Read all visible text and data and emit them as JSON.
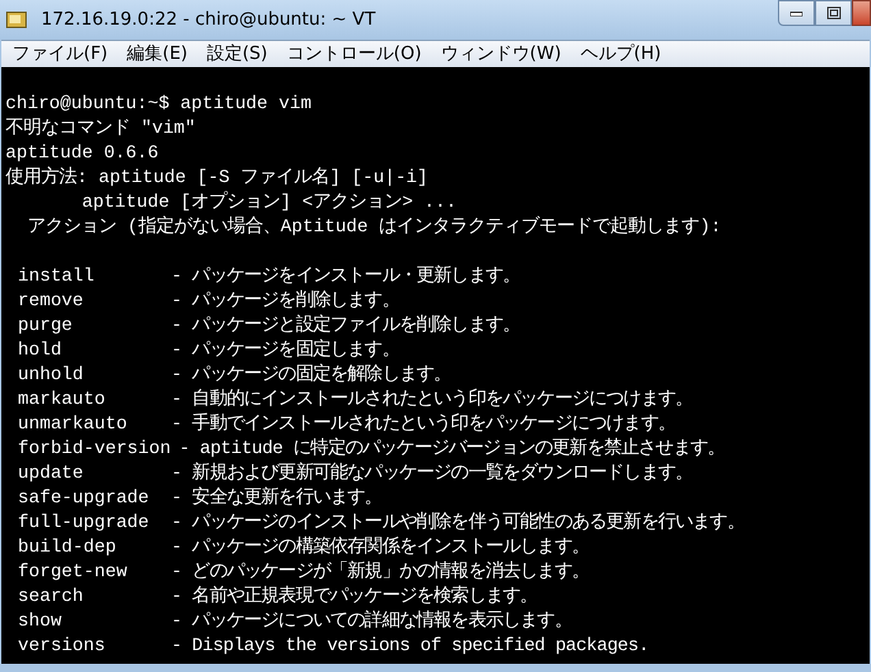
{
  "window": {
    "title": "172.16.19.0:22 - chiro@ubuntu: ~ VT"
  },
  "menu": [
    {
      "label": "ファイル(F)"
    },
    {
      "label": "編集(E)"
    },
    {
      "label": "設定(S)"
    },
    {
      "label": "コントロール(O)"
    },
    {
      "label": "ウィンドウ(W)"
    },
    {
      "label": "ヘルプ(H)"
    }
  ],
  "terminal": {
    "lines": [
      "chiro@ubuntu:~$ aptitude vim",
      "不明なコマンド \"vim\"",
      "aptitude 0.6.6",
      "使用方法: aptitude [-S ファイル名] [-u|-i]",
      "       aptitude [オプション] <アクション> ...",
      "  アクション (指定がない場合、Aptitude はインタラクティブモードで起動します):"
    ],
    "commands": [
      {
        "name": "install",
        "description": "- パッケージをインストール・更新します。"
      },
      {
        "name": "remove",
        "description": "- パッケージを削除します。"
      },
      {
        "name": "purge",
        "description": "- パッケージと設定ファイルを削除します。"
      },
      {
        "name": "hold",
        "description": "- パッケージを固定します。"
      },
      {
        "name": "unhold",
        "description": "- パッケージの固定を解除します。"
      },
      {
        "name": "markauto",
        "description": "- 自動的にインストールされたという印をパッケージにつけます。"
      },
      {
        "name": "unmarkauto",
        "description": "- 手動でインストールされたという印をパッケージにつけます。"
      },
      {
        "name": "forbid-version",
        "description": "- aptitude に特定のパッケージバージョンの更新を禁止させます。"
      },
      {
        "name": "update",
        "description": "- 新規および更新可能なパッケージの一覧をダウンロードします。"
      },
      {
        "name": "safe-upgrade",
        "description": "- 安全な更新を行います。"
      },
      {
        "name": "full-upgrade",
        "description": "- パッケージのインストールや削除を伴う可能性のある更新を行います。"
      },
      {
        "name": "build-dep",
        "description": "- パッケージの構築依存関係をインストールします。"
      },
      {
        "name": "forget-new",
        "description": "- どのパッケージが「新規」かの情報を消去します。"
      },
      {
        "name": "search",
        "description": "- 名前や正規表現でパッケージを検索します。"
      },
      {
        "name": "show",
        "description": "- パッケージについての詳細な情報を表示します。"
      },
      {
        "name": "versions",
        "description": "- Displays the versions of specified packages."
      }
    ]
  }
}
